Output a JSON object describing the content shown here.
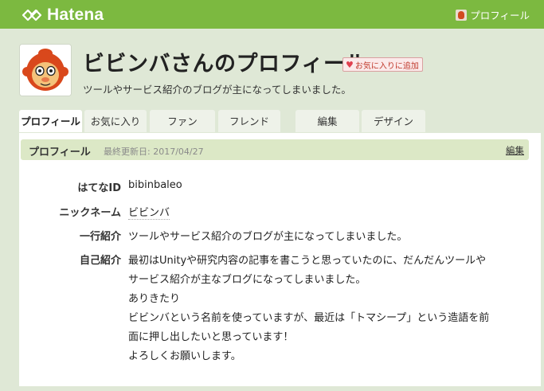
{
  "header": {
    "logo_text": "Hatena",
    "profile_link": "プロフィール"
  },
  "profile": {
    "title": "ビビンバさんのプロフィール",
    "fav_button": "お気に入りに追加",
    "description": "ツールやサービス紹介のブログが主になってしまいました。"
  },
  "tabs": [
    {
      "label": "プロフィール"
    },
    {
      "label": "お気に入り"
    },
    {
      "label": "ファン"
    },
    {
      "label": "フレンド"
    },
    {
      "label": "編集"
    },
    {
      "label": "デザイン"
    }
  ],
  "panel": {
    "title": "プロフィール",
    "updated": "最終更新日: 2017/04/27",
    "edit": "編集"
  },
  "fields": {
    "hatena_id_label": "はてなID",
    "hatena_id_value": "bibinbaleo",
    "nickname_label": "ニックネーム",
    "nickname_value": "ビビンバ",
    "oneline_label": "一行紹介",
    "oneline_value": "ツールやサービス紹介のブログが主になってしまいました。",
    "bio_label": "自己紹介",
    "bio_lines": [
      "最初はUnityや研究内容の記事を書こうと思っていたのに、だんだんツールや",
      "サービス紹介が主なブログになってしまいました。",
      "ありきたり",
      "ビビンバという名前を使っていますが、最近は「トマシープ」という造語を前",
      "面に押し出したいと思っています！",
      "よろしくお願いします。"
    ]
  },
  "colors": {
    "topbar": "#7cb940",
    "background": "#dfe8d6",
    "panel_head": "#dce8c6"
  }
}
